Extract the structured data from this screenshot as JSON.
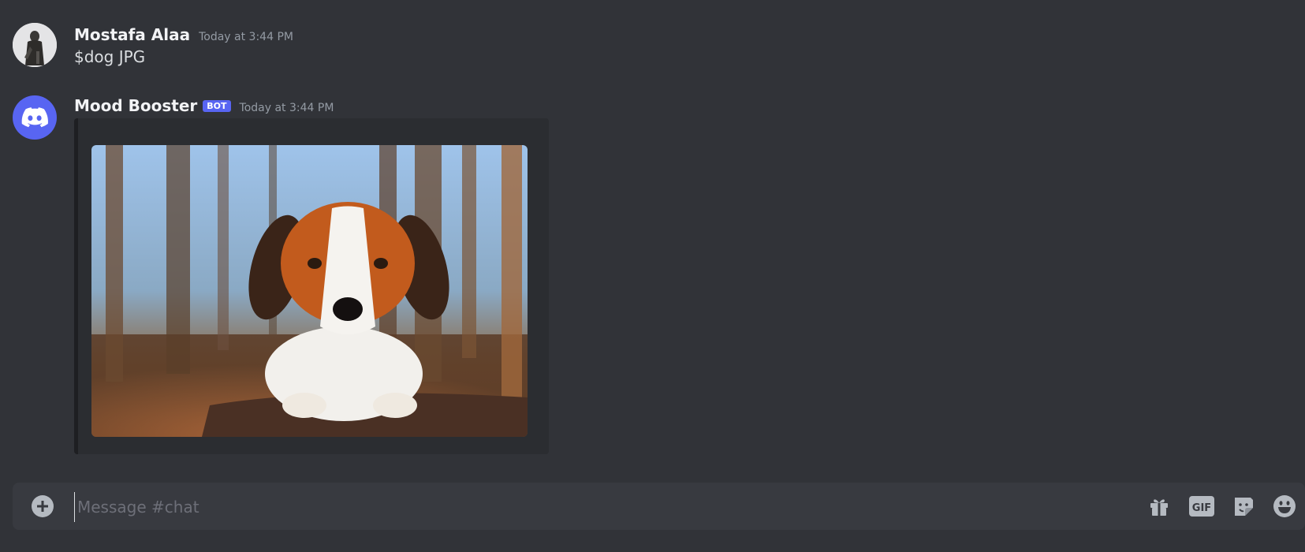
{
  "messages": [
    {
      "username": "Mostafa Alaa",
      "timestamp": "Today at 3:44 PM",
      "content": "$dog JPG"
    },
    {
      "username": "Mood Booster",
      "badge": "BOT",
      "timestamp": "Today at 3:44 PM",
      "embed_image": "dog photo"
    }
  ],
  "composer": {
    "placeholder": "Message #chat",
    "gif_label": "GIF"
  },
  "icons": [
    "add-circle-icon",
    "gift-icon",
    "gif-icon",
    "sticker-icon",
    "emoji-icon",
    "discord-logo-icon"
  ],
  "colors": {
    "background": "#313338",
    "bot_badge": "#5865f2",
    "input": "#383a40",
    "icon": "#b5bac1"
  }
}
